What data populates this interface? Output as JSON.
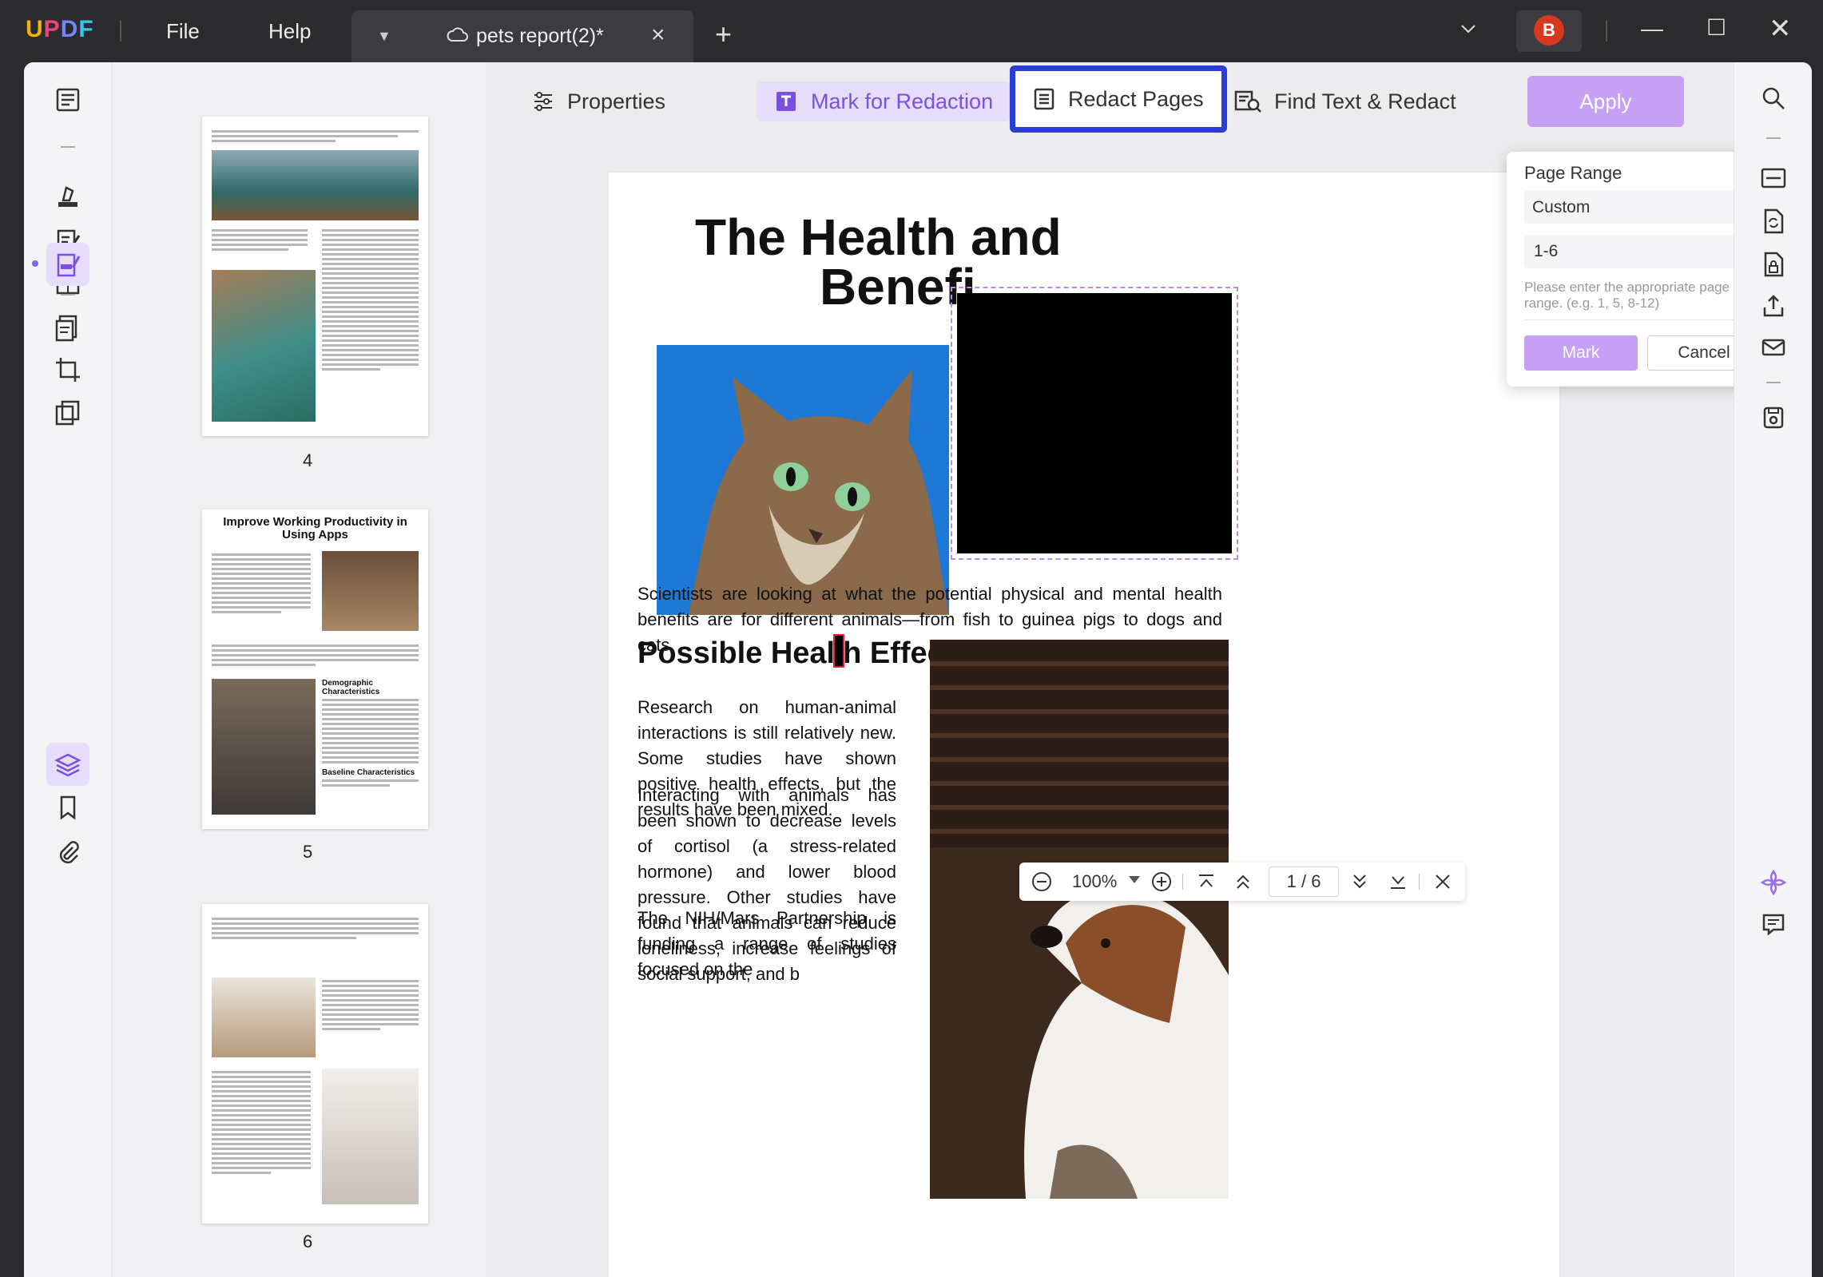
{
  "app": {
    "logo": "UPDF"
  },
  "menu": {
    "file": "File",
    "help": "Help"
  },
  "tab": {
    "title": "pets report(2)*"
  },
  "user": {
    "initial": "B"
  },
  "toolbar": {
    "properties": "Properties",
    "mark_for_redaction": "Mark for Redaction",
    "redact_pages": "Redact Pages",
    "find_text_redact": "Find Text & Redact",
    "apply": "Apply"
  },
  "popover": {
    "label": "Page Range",
    "select_value": "Custom",
    "range_value": "1-6",
    "hint": "Please enter the appropriate page range. (e.g. 1, 5, 8-12)",
    "mark": "Mark",
    "cancel": "Cancel"
  },
  "thumbnails": [
    {
      "number": "4"
    },
    {
      "number": "5",
      "title": "Improve Working Productivity in Using Apps",
      "sub1": "Demographic Characteristics",
      "sub2": "Baseline Characteristics"
    },
    {
      "number": "6"
    }
  ],
  "page": {
    "title_line1": "The Health and",
    "title_line2": "Benefi",
    "caption": "Scientists are looking at what the potential physical and mental health benefits are for different animals—from fish to guinea pigs to dogs and cats.",
    "heading_a": "Possible Heal",
    "heading_b": "h Effects",
    "para1": "Research on human-animal interactions is still relatively new. Some studies have shown positive health effects, but the results have been mixed.",
    "para2": "Interacting with animals has been shown to decrease levels of cortisol (a stress-related hormone) and lower blood pressure. Other studies have found that animals can reduce loneliness, increase feelings of social support, and b",
    "para3": "The NIH/Mars Partnership is funding a range of studies focused on the"
  },
  "nav": {
    "zoom": "100%",
    "page_current": "1",
    "page_sep": "/",
    "page_total": "6"
  },
  "colors": {
    "accent": "#8a63e8",
    "highlight_border": "#2c3dd4",
    "apply": "#c6a0f5"
  }
}
